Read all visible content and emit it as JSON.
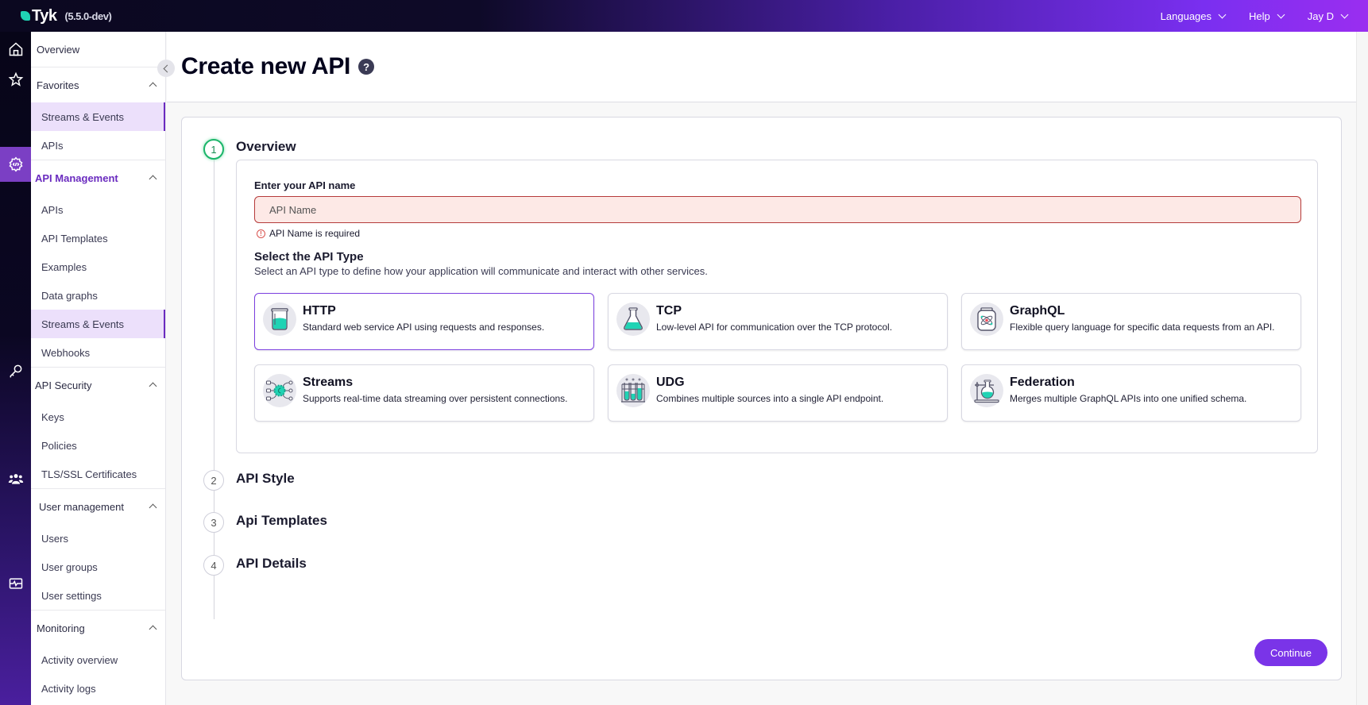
{
  "topbar": {
    "logo": "Tyk",
    "version": "(5.5.0-dev)",
    "menu": [
      {
        "label": "Languages"
      },
      {
        "label": "Help"
      },
      {
        "label": "Jay D"
      }
    ]
  },
  "rail": {
    "icons": [
      "home-icon",
      "star-icon",
      "api-management-icon",
      "key-icon",
      "users-icon",
      "monitoring-icon"
    ]
  },
  "sidebar": {
    "overview": "Overview",
    "sections": [
      {
        "title": "Favorites",
        "items": [
          "Streams & Events",
          "APIs"
        ],
        "selected": 0
      },
      {
        "title": "API Management",
        "items": [
          "APIs",
          "API Templates",
          "Examples",
          "Data graphs",
          "Streams & Events",
          "Webhooks"
        ],
        "selected": 4
      },
      {
        "title": "API Security",
        "items": [
          "Keys",
          "Policies",
          "TLS/SSL Certificates"
        ]
      },
      {
        "title": "User management",
        "items": [
          "Users",
          "User groups",
          "User settings"
        ]
      },
      {
        "title": "Monitoring",
        "items": [
          "Activity overview",
          "Activity logs"
        ]
      }
    ]
  },
  "page": {
    "title": "Create new API",
    "help": "?"
  },
  "steps": [
    {
      "num": "1",
      "title": "Overview",
      "active": true
    },
    {
      "num": "2",
      "title": "API Style"
    },
    {
      "num": "3",
      "title": "Api Templates"
    },
    {
      "num": "4",
      "title": "API Details"
    }
  ],
  "form": {
    "name_label": "Enter your API name",
    "name_placeholder": "API Name",
    "name_value": "",
    "error": "API Name is required",
    "type_title": "Select the API Type",
    "type_subtitle": "Select an API type to define how your application will communicate and interact with other services.",
    "types": [
      {
        "name": "HTTP",
        "desc": "Standard web service API using requests and responses.",
        "icon": "beaker-icon",
        "selected": true
      },
      {
        "name": "TCP",
        "desc": "Low-level API for communication over the TCP protocol.",
        "icon": "flask-icon"
      },
      {
        "name": "GraphQL",
        "desc": "Flexible query language for specific data requests from an API.",
        "icon": "atom-jar-icon"
      },
      {
        "name": "Streams",
        "desc": "Supports real-time data streaming over persistent connections.",
        "icon": "streams-network-icon"
      },
      {
        "name": "UDG",
        "desc": "Combines multiple sources into a single API endpoint.",
        "icon": "test-tubes-icon"
      },
      {
        "name": "Federation",
        "desc": "Merges multiple GraphQL APIs into one unified schema.",
        "icon": "lab-stand-icon"
      }
    ]
  },
  "actions": {
    "continue": "Continue"
  },
  "colors": {
    "accent": "#7a34e8",
    "teal": "#20d3b4",
    "error_bg": "#fde9e6",
    "error_border": "#b53b3b",
    "step_active": "#1bb56a"
  }
}
